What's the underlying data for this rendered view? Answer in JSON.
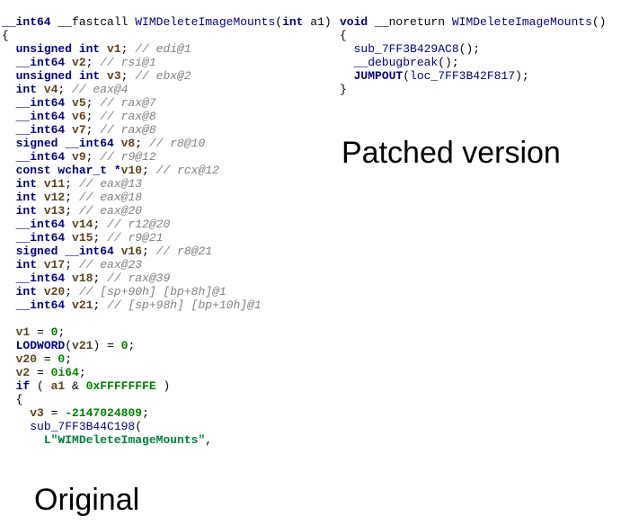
{
  "labels": {
    "original": "Original",
    "patched": "Patched version"
  },
  "left": {
    "l0_tp1": "__int64",
    "l0_cc": " __fastcall ",
    "l0_fn": "WIMDeleteImageMounts",
    "l0_pa": "(",
    "l0_tp2": "int",
    "l0_a1": " a1)",
    "l1": "{",
    "l2_t": "unsigned int",
    "l2_v": " v1",
    "l2_s": "; ",
    "l2_c": "// edi@1",
    "l3_t": "__int64",
    "l3_v": " v2",
    "l3_s": "; ",
    "l3_c": "// rsi@1",
    "l4_t": "unsigned int",
    "l4_v": " v3",
    "l4_s": "; ",
    "l4_c": "// ebx@2",
    "l5_t": "int",
    "l5_v": " v4",
    "l5_s": "; ",
    "l5_c": "// eax@4",
    "l6_t": "__int64",
    "l6_v": " v5",
    "l6_s": "; ",
    "l6_c": "// rax@7",
    "l7_t": "__int64",
    "l7_v": " v6",
    "l7_s": "; ",
    "l7_c": "// rax@8",
    "l8_t": "__int64",
    "l8_v": " v7",
    "l8_s": "; ",
    "l8_c": "// rax@8",
    "l9_t": "signed __int64",
    "l9_v": " v8",
    "l9_s": "; ",
    "l9_c": "// r8@10",
    "l10_t": "__int64",
    "l10_v": " v9",
    "l10_s": "; ",
    "l10_c": "// r9@12",
    "l11_t": "const wchar_t *",
    "l11_v": "v10",
    "l11_s": "; ",
    "l11_c": "// rcx@12",
    "l12_t": "int",
    "l12_v": " v11",
    "l12_s": "; ",
    "l12_c": "// eax@13",
    "l13_t": "int",
    "l13_v": " v12",
    "l13_s": "; ",
    "l13_c": "// eax@18",
    "l14_t": "int",
    "l14_v": " v13",
    "l14_s": "; ",
    "l14_c": "// eax@20",
    "l15_t": "__int64",
    "l15_v": " v14",
    "l15_s": "; ",
    "l15_c": "// r12@20",
    "l16_t": "__int64",
    "l16_v": " v15",
    "l16_s": "; ",
    "l16_c": "// r9@21",
    "l17_t": "signed __int64",
    "l17_v": " v16",
    "l17_s": "; ",
    "l17_c": "// r8@21",
    "l18_t": "int",
    "l18_v": " v17",
    "l18_s": "; ",
    "l18_c": "// eax@23",
    "l19_t": "__int64",
    "l19_v": " v18",
    "l19_s": "; ",
    "l19_c": "// rax@39",
    "l20_t": "int",
    "l20_v": " v20",
    "l20_s": "; ",
    "l20_c": "// [sp+90h] [bp+8h]@1",
    "l21_t": "__int64",
    "l21_v": " v21",
    "l21_s": "; ",
    "l21_c": "// [sp+98h] [bp+10h]@1",
    "blank": "",
    "l23_v": "v1",
    "l23_op": " = ",
    "l23_n": "0",
    "l23_s": ";",
    "l24_f": "LODWORD",
    "l24_p": "(",
    "l24_v": "v21",
    "l24_cp": ") = ",
    "l24_n": "0",
    "l24_s": ";",
    "l25_v": "v20",
    "l25_op": " = ",
    "l25_n": "0",
    "l25_s": ";",
    "l26_v": "v2",
    "l26_op": " = ",
    "l26_n": "0i64",
    "l26_s": ";",
    "l27_k": "if",
    "l27_sp": " ( ",
    "l27_v": "a1",
    "l27_sp2": " & ",
    "l27_n": "0xFFFFFFFE",
    "l27_cp": " )",
    "l28": "{",
    "l29_v": "v3",
    "l29_op": " = ",
    "l29_n": "-2147024809",
    "l29_s": ";",
    "l30_f": "sub_7FF3B44C198",
    "l30_p": "(",
    "l31_l": "L",
    "l31_str": "\"WIMDeleteImageMounts\"",
    "l31_s": ","
  },
  "right": {
    "r0_t": "void",
    "r0_cc": " __noreturn ",
    "r0_fn": "WIMDeleteImageMounts",
    "r0_p": "()",
    "r1": "{",
    "r2_f": "sub_7FF3B429AC8",
    "r2_p": "();",
    "r3_f": "__debugbreak",
    "r3_p": "();",
    "r4_f": "JUMPOUT",
    "r4_p1": "(",
    "r4_a": "loc_7FF3B42F817",
    "r4_p2": ");",
    "r5": "}"
  }
}
